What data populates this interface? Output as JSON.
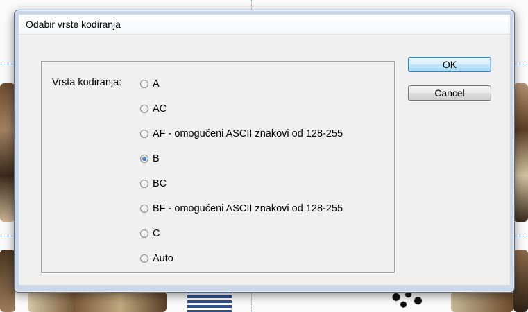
{
  "dialog": {
    "title": "Odabir vrste kodiranja",
    "group_label": "Vrsta kodiranja:",
    "options": [
      {
        "label": "A",
        "checked": false
      },
      {
        "label": "AC",
        "checked": false
      },
      {
        "label": "AF - omogućeni ASCII znakovi od 128-255",
        "checked": false
      },
      {
        "label": "B",
        "checked": true
      },
      {
        "label": "BC",
        "checked": false
      },
      {
        "label": "BF - omogućeni ASCII znakovi od 128-255",
        "checked": false
      },
      {
        "label": "C",
        "checked": false
      },
      {
        "label": "Auto",
        "checked": false
      }
    ],
    "ok_label": "OK",
    "cancel_label": "Cancel"
  },
  "colors": {
    "window_frame": "#c9d7e8",
    "default_button": "#bee6fd",
    "radio_selected": "#1a4f9c"
  }
}
